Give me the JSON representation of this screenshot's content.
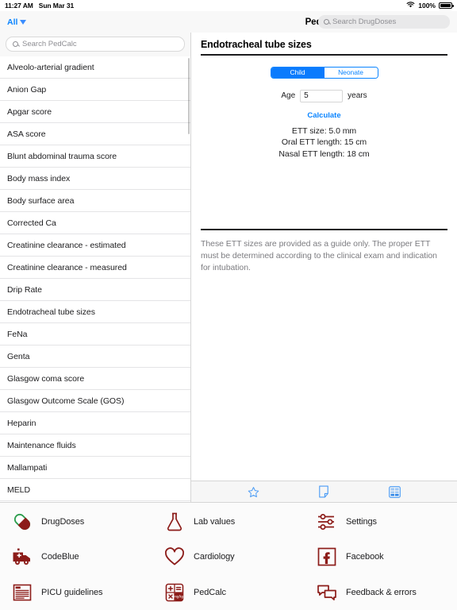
{
  "statusbar": {
    "time": "11:27 AM",
    "date": "Sun Mar 31",
    "battery_pct": "100%",
    "wifi_icon": "wifi-icon",
    "battery_icon": "battery-full-icon"
  },
  "navbar": {
    "filter_label": "All",
    "filter_icon": "chevron-down-icon",
    "title": "Ped Calc",
    "search_placeholder": "Search DrugDoses",
    "search_value": "",
    "search_icon": "search-icon"
  },
  "master": {
    "search_placeholder": "Search PedCalc",
    "search_value": "",
    "search_icon": "search-icon",
    "items": [
      {
        "label": "Alveolo-arterial gradient"
      },
      {
        "label": "Anion Gap"
      },
      {
        "label": "Apgar score"
      },
      {
        "label": "ASA score"
      },
      {
        "label": "Blunt abdominal trauma score"
      },
      {
        "label": "Body mass index"
      },
      {
        "label": "Body surface area"
      },
      {
        "label": "Corrected Ca"
      },
      {
        "label": "Creatinine clearance - estimated"
      },
      {
        "label": "Creatinine clearance - measured"
      },
      {
        "label": "Drip Rate"
      },
      {
        "label": "Endotracheal tube sizes"
      },
      {
        "label": "FeNa"
      },
      {
        "label": "Genta"
      },
      {
        "label": "Glasgow coma score"
      },
      {
        "label": "Glasgow Outcome Scale (GOS)"
      },
      {
        "label": "Heparin"
      },
      {
        "label": "Maintenance fluids"
      },
      {
        "label": "Mallampati"
      },
      {
        "label": "MELD"
      }
    ]
  },
  "detail": {
    "title": "Endotracheal tube sizes",
    "segments": [
      {
        "label": "Child",
        "selected": true
      },
      {
        "label": "Neonate",
        "selected": false
      }
    ],
    "field": {
      "label": "Age",
      "value": "5",
      "unit": "years"
    },
    "calculate_label": "Calculate",
    "results": [
      "ETT size: 5.0 mm",
      "Oral ETT length: 15 cm",
      "Nasal ETT length: 18 cm"
    ],
    "disclaimer": "These ETT sizes are provided as a guide only. The proper ETT must be determined according to the clinical exam and indication for intubation.",
    "toolbar": [
      {
        "icon": "star-icon"
      },
      {
        "icon": "note-icon"
      },
      {
        "icon": "calculator-icon"
      }
    ]
  },
  "launcher": {
    "apps": [
      {
        "label": "DrugDoses",
        "icon": "pill-icon"
      },
      {
        "label": "Lab values",
        "icon": "flask-icon"
      },
      {
        "label": "Settings",
        "icon": "sliders-icon"
      },
      {
        "label": "CodeBlue",
        "icon": "ambulance-icon"
      },
      {
        "label": "Cardiology",
        "icon": "heart-icon"
      },
      {
        "label": "Facebook",
        "icon": "facebook-icon"
      },
      {
        "label": "PICU guidelines",
        "icon": "document-icon"
      },
      {
        "label": "PedCalc",
        "icon": "calculator-grid-icon"
      },
      {
        "label": "Feedback & errors",
        "icon": "speech-bubbles-icon"
      }
    ]
  },
  "colors": {
    "accent_blue": "#0a84ff",
    "brand_red": "#8c1c19",
    "pill_green": "#2e9e4f",
    "text": "#1c1c1e",
    "muted": "#8e8e93"
  }
}
